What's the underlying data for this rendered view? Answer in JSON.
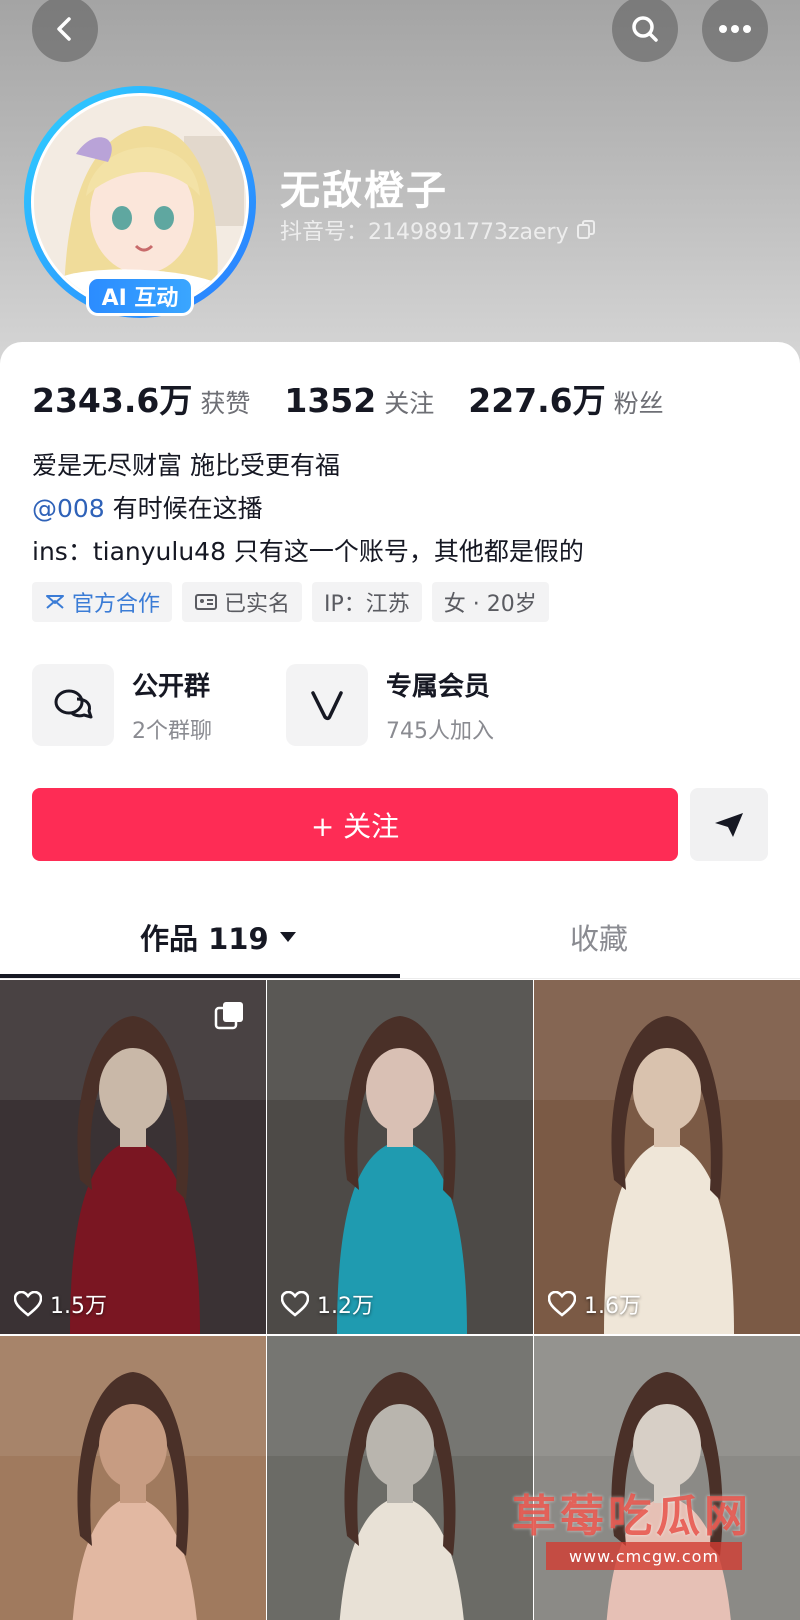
{
  "header": {
    "nickname": "无敌橙子",
    "douyin_id": "抖音号：2149891773zaery",
    "ai_badge": "AI 互动",
    "icons": [
      "back-arrow-icon",
      "search-icon",
      "more-icon",
      "copy-icon"
    ]
  },
  "stats": [
    {
      "value": "2343.6万",
      "label": "获赞"
    },
    {
      "value": "1352",
      "label": "关注"
    },
    {
      "value": "227.6万",
      "label": "粉丝"
    }
  ],
  "bio": {
    "line1": "爱是无尽财富 施比受更有福",
    "mention": "@008",
    "line2_rest": " 有时候在这播",
    "line3": "ins：tianyulu48 只有这一个账号，其他都是假的"
  },
  "tags": [
    {
      "label": "官方合作",
      "icon": "official-icon"
    },
    {
      "label": "已实名",
      "icon": "id-card-icon"
    },
    {
      "label": "IP：江苏"
    },
    {
      "label": "女 · 20岁"
    }
  ],
  "features": [
    {
      "title": "公开群",
      "subtitle": "2个群聊",
      "icon": "chat-icon"
    },
    {
      "title": "专属会员",
      "subtitle": "745人加入",
      "icon": "v-badge-icon"
    }
  ],
  "actions": {
    "follow": "+ 关注",
    "share_icon": "send-icon"
  },
  "tabs": {
    "works": "作品 119",
    "favorites": "收藏"
  },
  "videos": [
    {
      "likes": "1.5万",
      "multi": true,
      "colors": [
        "#3a3234",
        "#7a1622",
        "#c9b8a8"
      ]
    },
    {
      "likes": "1.2万",
      "multi": false,
      "colors": [
        "#4d4a47",
        "#1f9bb0",
        "#d9c0b4"
      ]
    },
    {
      "likes": "1.6万",
      "multi": false,
      "colors": [
        "#7b5a45",
        "#efe6d8",
        "#d9c2ae"
      ]
    },
    {
      "likes": "",
      "multi": false,
      "colors": [
        "#a07a5e",
        "#e2b8a2",
        "#c79c82"
      ]
    },
    {
      "likes": "",
      "multi": false,
      "colors": [
        "#6b6b66",
        "#e8e1d6",
        "#b9b5ae"
      ]
    },
    {
      "likes": "",
      "multi": false,
      "colors": [
        "#8b8a86",
        "#e6c0b5",
        "#d7cfc6"
      ]
    }
  ],
  "watermark": {
    "text": "草莓吃瓜网",
    "url": "www.cmcgw.com"
  }
}
